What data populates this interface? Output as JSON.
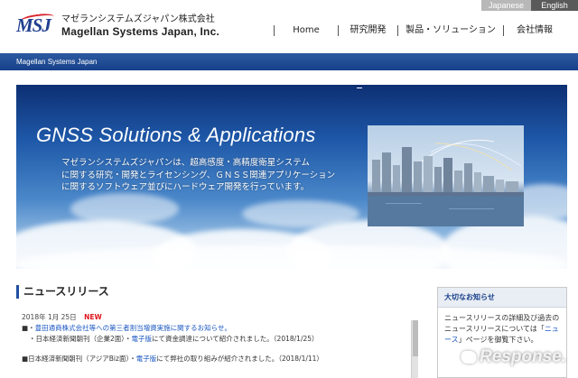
{
  "language": {
    "japanese": "Japanese",
    "english": "English"
  },
  "logo": {
    "mark": "MSJ",
    "company_jp": "マゼランシステムズジャパン株式会社",
    "company_en": "Magellan Systems Japan, Inc."
  },
  "nav": {
    "home": "Home",
    "rd": "研究開発",
    "products": "製品・ソリューション",
    "company": "会社情報"
  },
  "breadcrumb": "Magellan Systems Japan",
  "hero": {
    "title": "GNSS Solutions & Applications",
    "lines": [
      "マゼランシステムズジャパンは、超高感度・高精度衛星システム",
      "に関する研究・開発とライセンシング、ＧＮＳＳ関連アプリケーション",
      "に関するソフトウェア並びにハードウェア開発を行っています。"
    ]
  },
  "news": {
    "heading": "ニュースリリース",
    "date": "2018年 1月 25日",
    "new_badge": "NEW",
    "item1_bullet": "■・",
    "item1_link": "豊田通商株式会社等への第三者割当増資実施に関するお知らせ。",
    "item1_sub_prefix": "・日本経済新聞朝刊（企業2面）・",
    "item1_sub_link": "電子版",
    "item1_sub_suffix": "にて資金調達について紹介されました。（2018/1/25）",
    "item2_prefix": "■日本経済新聞朝刊（アジアBiz面）・",
    "item2_link": "電子版",
    "item2_suffix": "にて弊社の取り組みが紹介されました。（2018/1/11）"
  },
  "sidebar": {
    "heading": "大切なお知らせ",
    "text_before": "ニュースリリースの詳細及び過去のニュースリリースについては「",
    "link": "ニュース",
    "text_after": "」ページを御覧下さい。"
  },
  "watermark": "Response."
}
